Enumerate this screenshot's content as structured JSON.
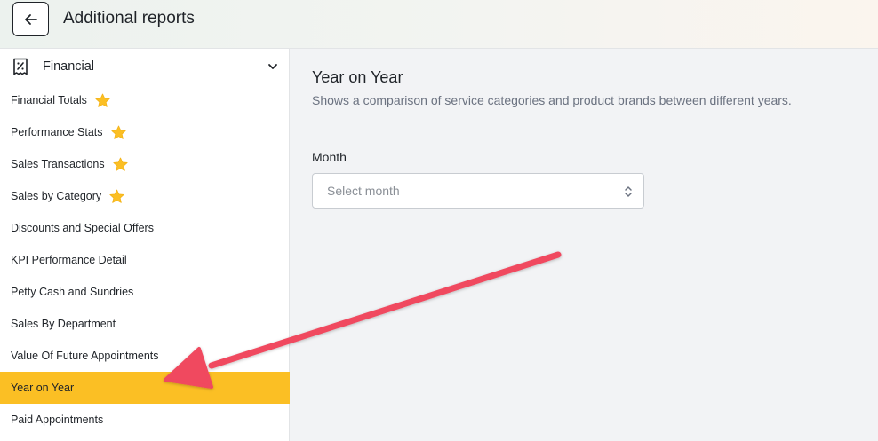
{
  "header": {
    "title": "Additional reports",
    "back_icon": "arrow-left-icon"
  },
  "sidebar": {
    "section": {
      "label": "Financial",
      "icon": "receipt-percent-icon",
      "chevron": "chevron-down-icon"
    },
    "items": [
      {
        "label": "Financial Totals",
        "starred": true,
        "active": false
      },
      {
        "label": "Performance Stats",
        "starred": true,
        "active": false
      },
      {
        "label": "Sales Transactions",
        "starred": true,
        "active": false
      },
      {
        "label": "Sales by Category",
        "starred": true,
        "active": false
      },
      {
        "label": "Discounts and Special Offers",
        "starred": false,
        "active": false
      },
      {
        "label": "KPI Performance Detail",
        "starred": false,
        "active": false
      },
      {
        "label": "Petty Cash and Sundries",
        "starred": false,
        "active": false
      },
      {
        "label": "Sales By Department",
        "starred": false,
        "active": false
      },
      {
        "label": "Value Of Future Appointments",
        "starred": false,
        "active": false
      },
      {
        "label": "Year on Year",
        "starred": false,
        "active": true
      },
      {
        "label": "Paid Appointments",
        "starred": false,
        "active": false
      }
    ]
  },
  "main": {
    "title": "Year on Year",
    "description": "Shows a comparison of service categories and product brands between different years.",
    "month_field": {
      "label": "Month",
      "placeholder": "Select month"
    }
  },
  "colors": {
    "active_bg": "#fbbf24",
    "star": "#fbbf24",
    "annotation_arrow": "#f0485e",
    "muted_text": "#6b7280"
  }
}
